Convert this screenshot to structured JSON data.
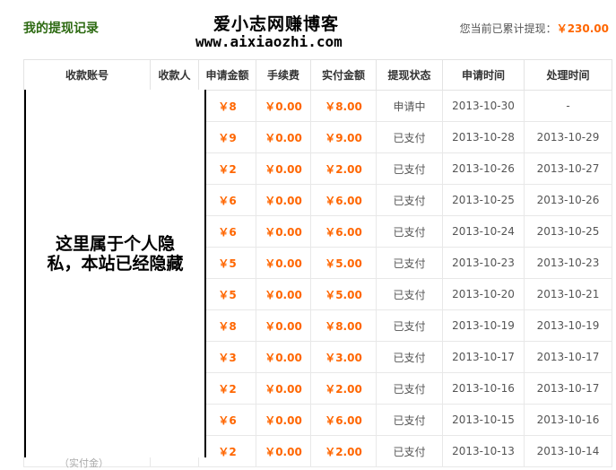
{
  "page_title": "我的提现记录",
  "watermark": {
    "name": "爱小志网赚博客",
    "url": "www.aixiaozhi.com"
  },
  "total": {
    "label": "您当前已累计提现：",
    "amount": "￥230.00"
  },
  "table": {
    "headers": [
      "收款账号",
      "收款人",
      "申请金额",
      "手续费",
      "实付金额",
      "提现状态",
      "申请时间",
      "处理时间"
    ],
    "rows": [
      {
        "amount": "￥8",
        "fee": "￥0.00",
        "paid": "￥8.00",
        "status": "申请中",
        "apply_date": "2013-10-30",
        "process_date": "-"
      },
      {
        "amount": "￥9",
        "fee": "￥0.00",
        "paid": "￥9.00",
        "status": "已支付",
        "apply_date": "2013-10-28",
        "process_date": "2013-10-29"
      },
      {
        "amount": "￥2",
        "fee": "￥0.00",
        "paid": "￥2.00",
        "status": "已支付",
        "apply_date": "2013-10-26",
        "process_date": "2013-10-27"
      },
      {
        "amount": "￥6",
        "fee": "￥0.00",
        "paid": "￥6.00",
        "status": "已支付",
        "apply_date": "2013-10-25",
        "process_date": "2013-10-26"
      },
      {
        "amount": "￥6",
        "fee": "￥0.00",
        "paid": "￥6.00",
        "status": "已支付",
        "apply_date": "2013-10-24",
        "process_date": "2013-10-25"
      },
      {
        "amount": "￥5",
        "fee": "￥0.00",
        "paid": "￥5.00",
        "status": "已支付",
        "apply_date": "2013-10-23",
        "process_date": "2013-10-23"
      },
      {
        "amount": "￥5",
        "fee": "￥0.00",
        "paid": "￥5.00",
        "status": "已支付",
        "apply_date": "2013-10-20",
        "process_date": "2013-10-21"
      },
      {
        "amount": "￥8",
        "fee": "￥0.00",
        "paid": "￥8.00",
        "status": "已支付",
        "apply_date": "2013-10-19",
        "process_date": "2013-10-19"
      },
      {
        "amount": "￥3",
        "fee": "￥0.00",
        "paid": "￥3.00",
        "status": "已支付",
        "apply_date": "2013-10-17",
        "process_date": "2013-10-17"
      },
      {
        "amount": "￥2",
        "fee": "￥0.00",
        "paid": "￥2.00",
        "status": "已支付",
        "apply_date": "2013-10-16",
        "process_date": "2013-10-17"
      },
      {
        "amount": "￥6",
        "fee": "￥0.00",
        "paid": "￥6.00",
        "status": "已支付",
        "apply_date": "2013-10-15",
        "process_date": "2013-10-16"
      },
      {
        "amount": "￥2",
        "fee": "￥0.00",
        "paid": "￥2.00",
        "status": "已支付",
        "apply_date": "2013-10-13",
        "process_date": "2013-10-14"
      }
    ]
  },
  "privacy_note": "这里属于个人隐私，本站已经隐藏",
  "stray_text": "（实付金）",
  "colors": {
    "title": "#2d6a12",
    "money": "#ff6600",
    "border": "#e8e8e8"
  }
}
